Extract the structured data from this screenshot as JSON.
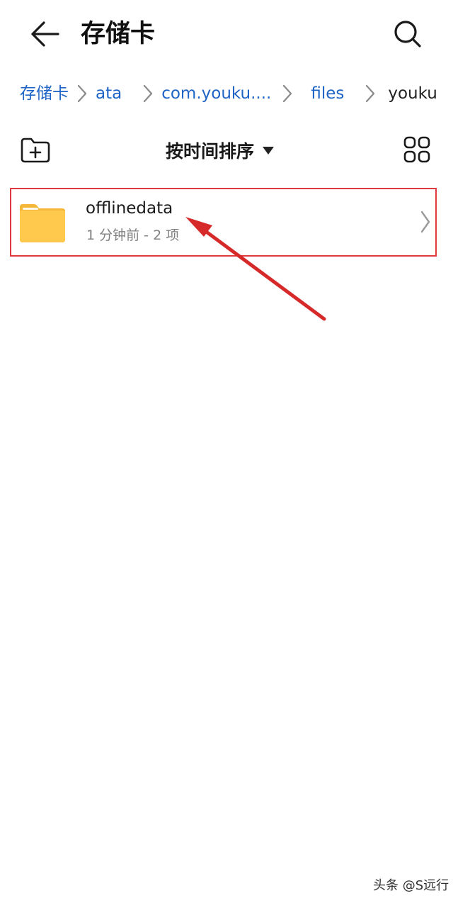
{
  "header": {
    "title": "存储卡",
    "back_icon": "arrow-left-icon",
    "search_icon": "search-icon"
  },
  "breadcrumb": {
    "items": [
      {
        "label": "存储卡"
      },
      {
        "label": "ata"
      },
      {
        "label": "com.youku...."
      },
      {
        "label": "files"
      },
      {
        "label": "youku"
      }
    ]
  },
  "toolbar": {
    "new_folder_icon": "new-folder-icon",
    "sort_label": "按时间排序",
    "grid_view_icon": "grid-view-icon"
  },
  "files": [
    {
      "name": "offlinedata",
      "meta": "1 分钟前 - 2 项",
      "icon": "folder-icon"
    }
  ],
  "colors": {
    "link": "#1e63c6",
    "highlight_box": "#e0393e",
    "folder": "#ffc94d",
    "arrow": "#d62a2a"
  },
  "watermark": "头条 @S远行"
}
